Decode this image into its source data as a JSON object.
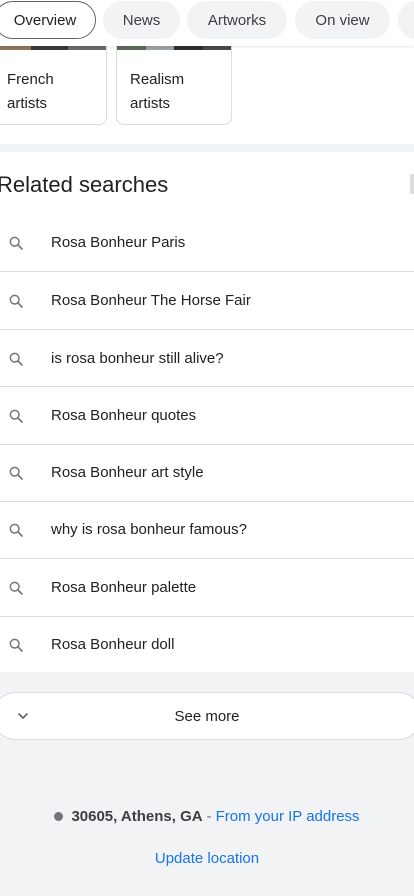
{
  "tabs": [
    {
      "label": "Overview",
      "active": true
    },
    {
      "label": "News",
      "active": false
    },
    {
      "label": "Artworks",
      "active": false
    },
    {
      "label": "On view",
      "active": false
    }
  ],
  "cards": [
    {
      "label": "French artists"
    },
    {
      "label": "Realism artists"
    }
  ],
  "related": {
    "title": "Related searches",
    "items": [
      "Rosa Bonheur Paris",
      "Rosa Bonheur The Horse Fair",
      "is rosa bonheur still alive?",
      "Rosa Bonheur quotes",
      "Rosa Bonheur art style",
      "why is rosa bonheur famous?",
      "Rosa Bonheur palette",
      "Rosa Bonheur doll"
    ]
  },
  "see_more": {
    "label": "See more"
  },
  "location": {
    "place": "30605, Athens, GA",
    "separator": "-",
    "source": "From your IP address",
    "update": "Update location"
  },
  "colors": {
    "link": "#1a73e8",
    "chip_bg": "#f1f3f4",
    "divider": "#dadce0"
  },
  "icons": [
    "search-icon",
    "chevron-down-icon"
  ]
}
